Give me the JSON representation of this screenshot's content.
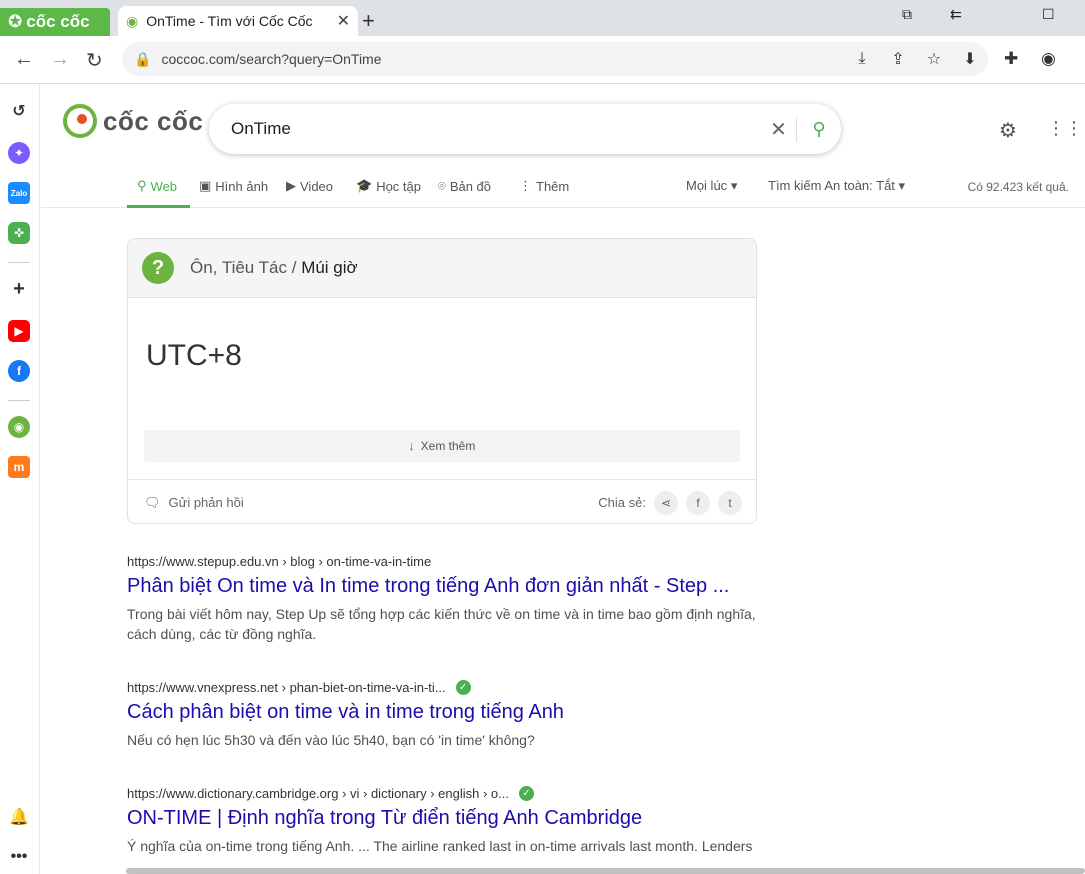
{
  "browser": {
    "brand_label": "cốc cốc",
    "tab_title": "OnTime - Tìm với Cốc Cốc",
    "url": "coccoc.com/search?query=OnTime"
  },
  "search": {
    "logo_text": "cốc cốc",
    "query": "OnTime"
  },
  "filters": {
    "tabs": [
      {
        "label": "Web",
        "icon": "web-icon"
      },
      {
        "label": "Hình ảnh",
        "icon": "image-icon"
      },
      {
        "label": "Video",
        "icon": "video-icon"
      },
      {
        "label": "Học tập",
        "icon": "graduation-icon"
      },
      {
        "label": "Bản đồ",
        "icon": "map-pin-icon"
      },
      {
        "label": "Thêm",
        "icon": "more-vertical-icon"
      }
    ],
    "time_filter": "Mọi lúc",
    "safe_search": "Tìm kiếm An toàn: Tắt",
    "result_count": "Có 92.423 kết quả."
  },
  "answer_card": {
    "breadcrumb_parent": "Ôn, Tiêu Tác",
    "breadcrumb_sep": " / ",
    "breadcrumb_current": "Múi giờ",
    "value": "UTC+8",
    "more_label": "Xem thêm",
    "feedback_label": "Gửi phản hồi",
    "share_label": "Chia sẻ:"
  },
  "results": [
    {
      "cite": "https://www.stepup.edu.vn › blog › on-time-va-in-time",
      "title": "Phân biệt On time và In time trong tiếng Anh đơn giản nhất - Step ...",
      "snippet": "Trong bài viết hôm nay, Step Up sẽ tổng hợp các kiến thức về on time và in time bao gồm định nghĩa, cách dùng, các từ đồng nghĩa.",
      "verified": false
    },
    {
      "cite": "https://www.vnexpress.net › phan-biet-on-time-va-in-ti...",
      "title": "Cách phân biệt on time và in time trong tiếng Anh",
      "snippet": "Nếu có hẹn lúc 5h30 và đến vào lúc 5h40, bạn có 'in time' không?",
      "verified": true
    },
    {
      "cite": "https://www.dictionary.cambridge.org › vi › dictionary › english › o...",
      "title": "ON-TIME | Định nghĩa trong Từ điển tiếng Anh Cambridge",
      "snippet": "Ý nghĩa của on-time trong tiếng Anh. ... The airline ranked last in on-time arrivals last month. Lenders",
      "verified": true
    }
  ],
  "colors": {
    "brand_green": "#5db947",
    "link_blue": "#1a0dab",
    "accent_green": "#4caf50"
  }
}
